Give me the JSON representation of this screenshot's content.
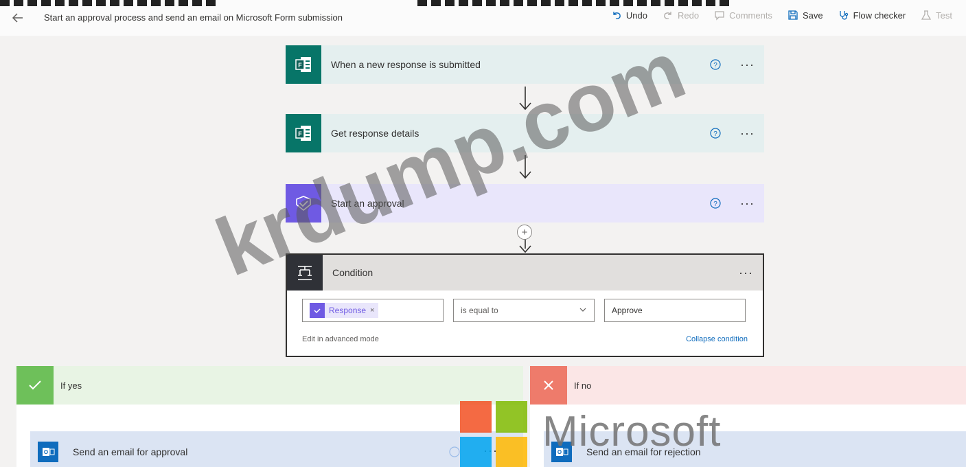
{
  "header": {
    "flow_title": "Start an approval process and send an email on Microsoft Form submission",
    "commands": {
      "undo": "Undo",
      "redo": "Redo",
      "comments": "Comments",
      "save": "Save",
      "flow_checker": "Flow checker",
      "test": "Test"
    }
  },
  "steps": {
    "trigger": {
      "title": "When a new response is submitted",
      "icon": "microsoft-forms-icon"
    },
    "get_details": {
      "title": "Get response details",
      "icon": "microsoft-forms-icon"
    },
    "approval": {
      "title": "Start an approval",
      "icon": "approvals-icon"
    }
  },
  "condition": {
    "title": "Condition",
    "left_operand": "Response",
    "operator": "is equal to",
    "right_operand": "Approve",
    "edit_advanced": "Edit in advanced mode",
    "collapse": "Collapse condition"
  },
  "branches": {
    "yes": {
      "label": "If yes",
      "email_title": "Send an email for approval"
    },
    "no": {
      "label": "If no",
      "email_title": "Send an email for rejection"
    }
  },
  "overlays": {
    "watermark": "krdump.com",
    "logo_word": "Microsoft"
  },
  "colors": {
    "forms": "#077568",
    "approvals": "#6f5ae3",
    "yes": "#6ec05a",
    "no": "#ee7b6b",
    "outlook": "#0f6cbd"
  }
}
